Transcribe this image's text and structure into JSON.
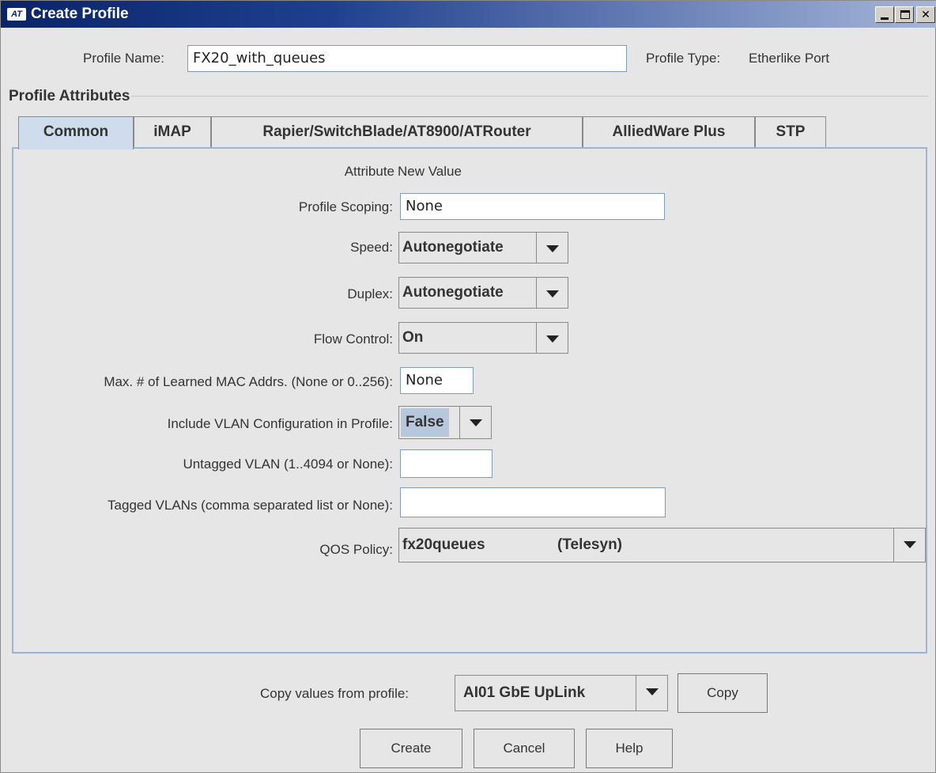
{
  "window": {
    "title": "Create Profile",
    "logo_text": "AT"
  },
  "header": {
    "profile_name_label": "Profile Name:",
    "profile_name_value": "FX20_with_queues",
    "profile_type_label": "Profile Type:",
    "profile_type_value": "Etherlike Port"
  },
  "section": {
    "title": "Profile Attributes"
  },
  "tabs": [
    {
      "label": "Common",
      "active": true
    },
    {
      "label": "iMAP",
      "active": false
    },
    {
      "label": "Rapier/SwitchBlade/AT8900/ATRouter",
      "active": false
    },
    {
      "label": "AlliedWare Plus",
      "active": false
    },
    {
      "label": "STP",
      "active": false
    }
  ],
  "columns": {
    "attribute": "Attribute",
    "new_value": "New Value"
  },
  "attributes": {
    "profile_scoping": {
      "label": "Profile Scoping:",
      "value": "None"
    },
    "speed": {
      "label": "Speed:",
      "value": "Autonegotiate"
    },
    "duplex": {
      "label": "Duplex:",
      "value": "Autonegotiate"
    },
    "flow_control": {
      "label": "Flow Control:",
      "value": "On"
    },
    "max_mac": {
      "label": "Max. # of Learned MAC Addrs. (None or 0..256):",
      "value": "None"
    },
    "include_vlan": {
      "label": "Include VLAN Configuration in Profile:",
      "value": "False"
    },
    "untagged_vlan": {
      "label": "Untagged VLAN (1..4094 or None):",
      "value": ""
    },
    "tagged_vlans": {
      "label": "Tagged VLANs (comma separated list or None):",
      "value": ""
    },
    "qos_policy": {
      "label": "QOS Policy:",
      "value": "fx20queues",
      "source": "(Telesyn)"
    }
  },
  "copy": {
    "label": "Copy values from profile:",
    "profile_value": "AI01 GbE UpLink",
    "button": "Copy"
  },
  "buttons": {
    "create": "Create",
    "cancel": "Cancel",
    "help": "Help"
  },
  "colors": {
    "titlebar_start": "#0a246a",
    "titlebar_end": "#a6b6d8",
    "active_tab": "#cfdcec",
    "panel_border": "#9db3cf",
    "highlight_select": "#b8c8dc"
  }
}
